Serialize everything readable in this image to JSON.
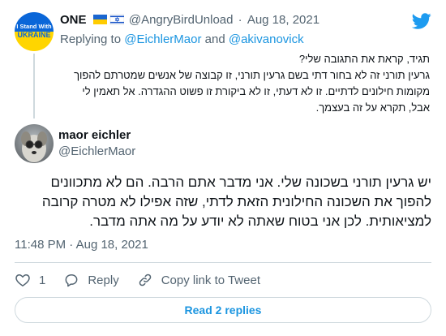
{
  "colors": {
    "accent": "#1d9bf0",
    "link": "#1b95e0",
    "muted": "#536471",
    "border": "#cfd9de"
  },
  "parent_tweet": {
    "avatar_icon": "stand-with-ukraine-avatar",
    "avatar_text_line1": "I Stand With",
    "avatar_text_line2": "UKRAINE",
    "display_name": "ONE",
    "flags_icon": "ukraine-and-israel-flags",
    "handle": "@AngryBirdUnload",
    "separator": "·",
    "date": "Aug 18, 2021",
    "replying_prefix": "Replying to",
    "replying_to_1": "@EichlerMaor",
    "replying_and": "and",
    "replying_to_2": "@akivanovick",
    "text": "תגיד, קראת את התגובה שלי?\nגרעין תורני זה לא בחור דתי בשם גרעין תורני, זו קבוצה של אנשים שמטרתם להפוך מקומות חילונים לדתיים. זו לא דעתי, זו לא ביקורת זו פשוט ההגדרה. אל תאמין לי אבל, תקרא על זה בעצמך."
  },
  "main_tweet": {
    "avatar_icon": "dog-avatar",
    "display_name": "maor eichler",
    "handle": "@EichlerMaor",
    "text": "יש גרעין תורני בשכונה שלי. אני מדבר אתם הרבה. הם לא מתכוונים להפוך את השכונה החילונית הזאת לדתי, שזה אפילו לא מטרה קרובה למציאותית. לכן אני בטוח שאתה לא יודע על מה אתה מדבר.",
    "time": "11:48 PM",
    "separator": "·",
    "date": "Aug 18, 2021"
  },
  "actions": {
    "like_count": "1",
    "reply_label": "Reply",
    "copy_label": "Copy link to Tweet"
  },
  "read_replies_label": "Read 2 replies",
  "brand_icon": "twitter-bird-icon"
}
